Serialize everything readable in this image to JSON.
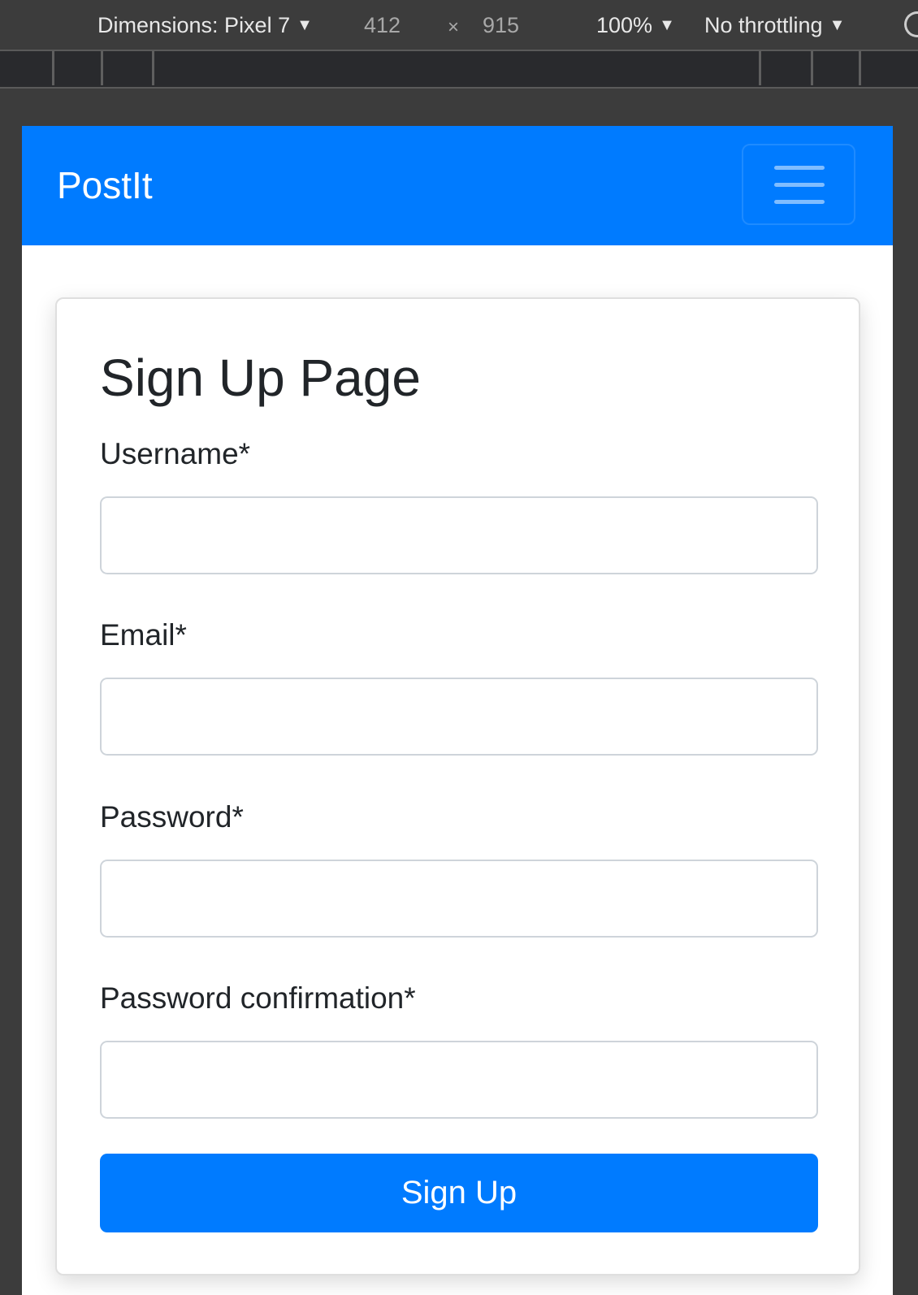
{
  "devtools": {
    "dimensions_label": "Dimensions: Pixel 7",
    "width": "412",
    "times": "×",
    "height": "915",
    "zoom": "100%",
    "throttling": "No throttling",
    "caret": "▼",
    "rotate_icon": "rotate-icon"
  },
  "navbar": {
    "brand": "PostIt",
    "background": "#007bff",
    "toggler_icon": "hamburger-icon"
  },
  "form": {
    "title": "Sign Up Page",
    "fields": [
      {
        "label": "Username*",
        "value": "",
        "placeholder": ""
      },
      {
        "label": "Email*",
        "value": "",
        "placeholder": ""
      },
      {
        "label": "Password*",
        "value": "",
        "placeholder": ""
      },
      {
        "label": "Password confirmation*",
        "value": "",
        "placeholder": ""
      }
    ],
    "submit_label": "Sign Up"
  }
}
